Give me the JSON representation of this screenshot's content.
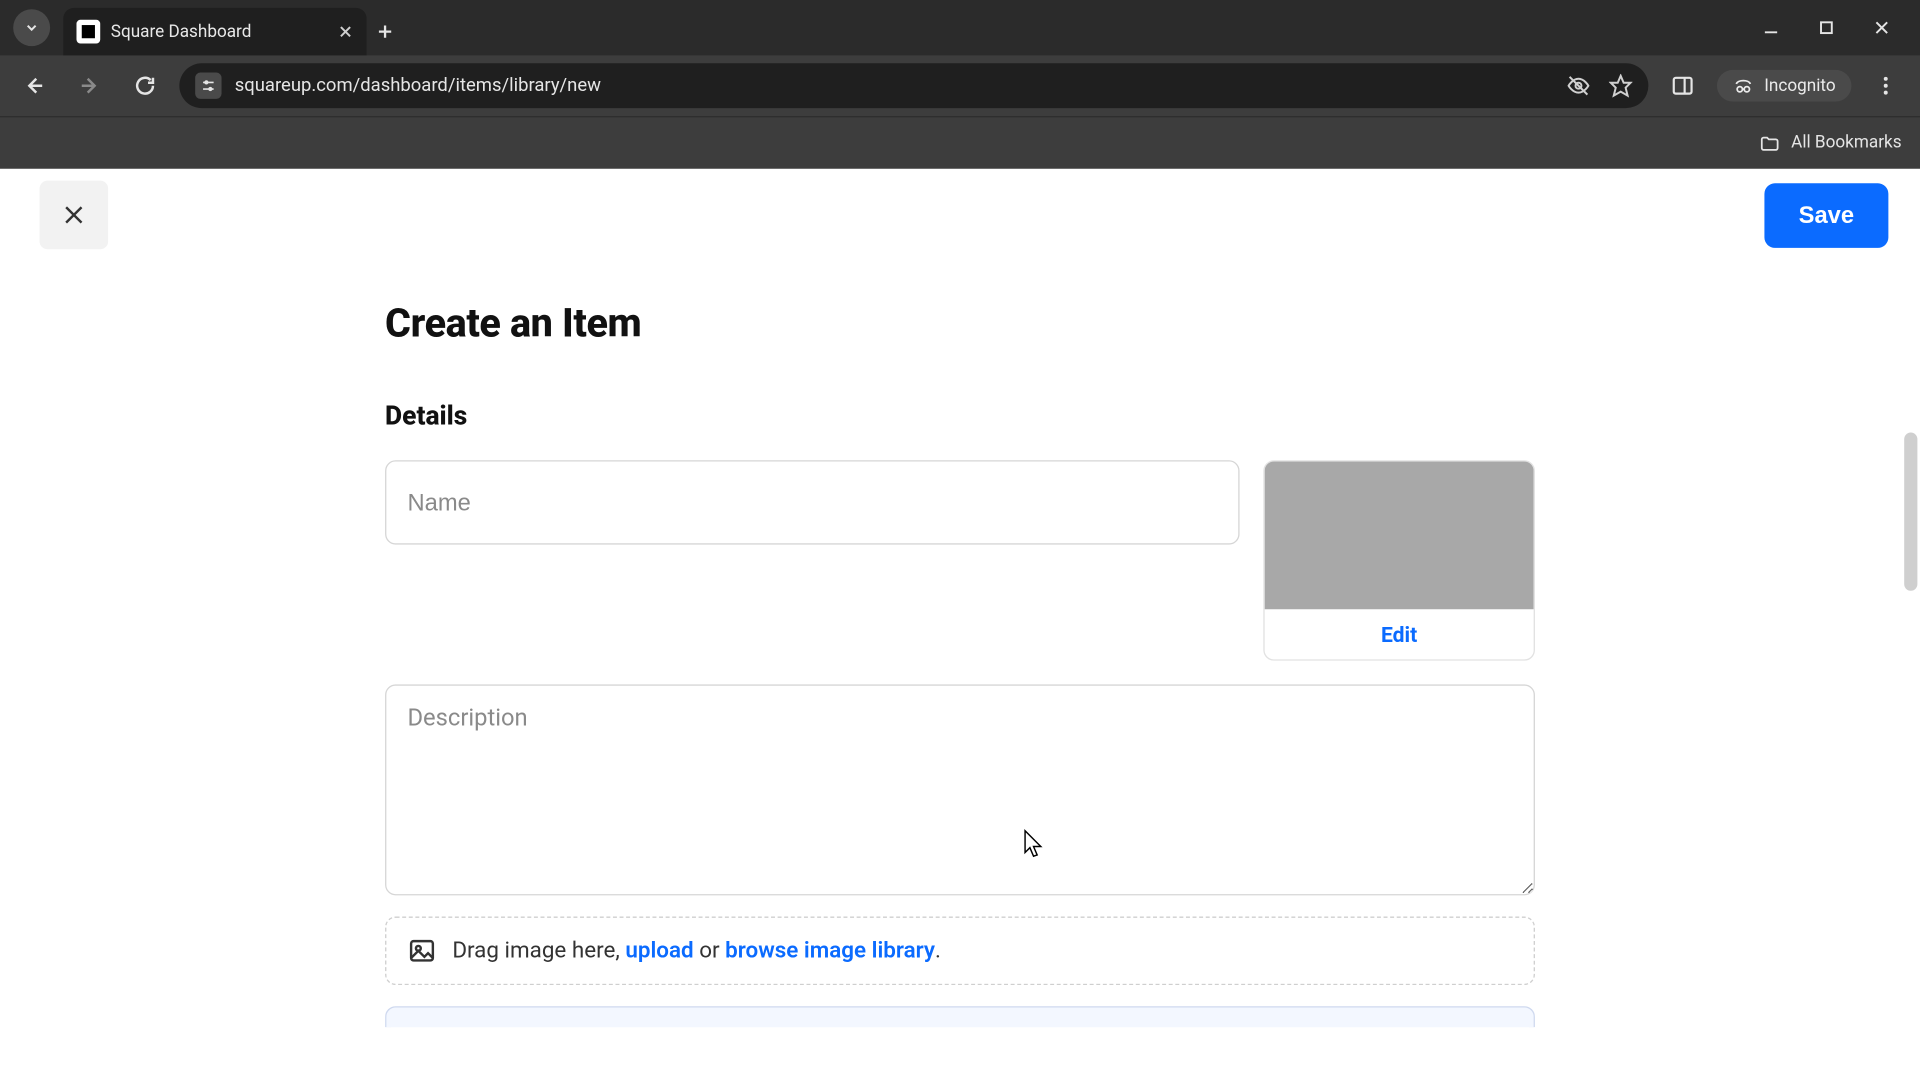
{
  "browser": {
    "tab_title": "Square Dashboard",
    "url": "squareup.com/dashboard/items/library/new",
    "incognito_label": "Incognito",
    "bookmarks_label": "All Bookmarks"
  },
  "page": {
    "close_aria": "Close",
    "save_label": "Save",
    "title": "Create an Item",
    "details": {
      "section_label": "Details",
      "name_placeholder": "Name",
      "name_value": "",
      "image_edit_label": "Edit",
      "description_placeholder": "Description",
      "description_value": "",
      "dropzone": {
        "prefix": "Drag image here, ",
        "upload_label": "upload",
        "middle": " or ",
        "browse_label": "browse image library",
        "suffix": "."
      }
    }
  }
}
